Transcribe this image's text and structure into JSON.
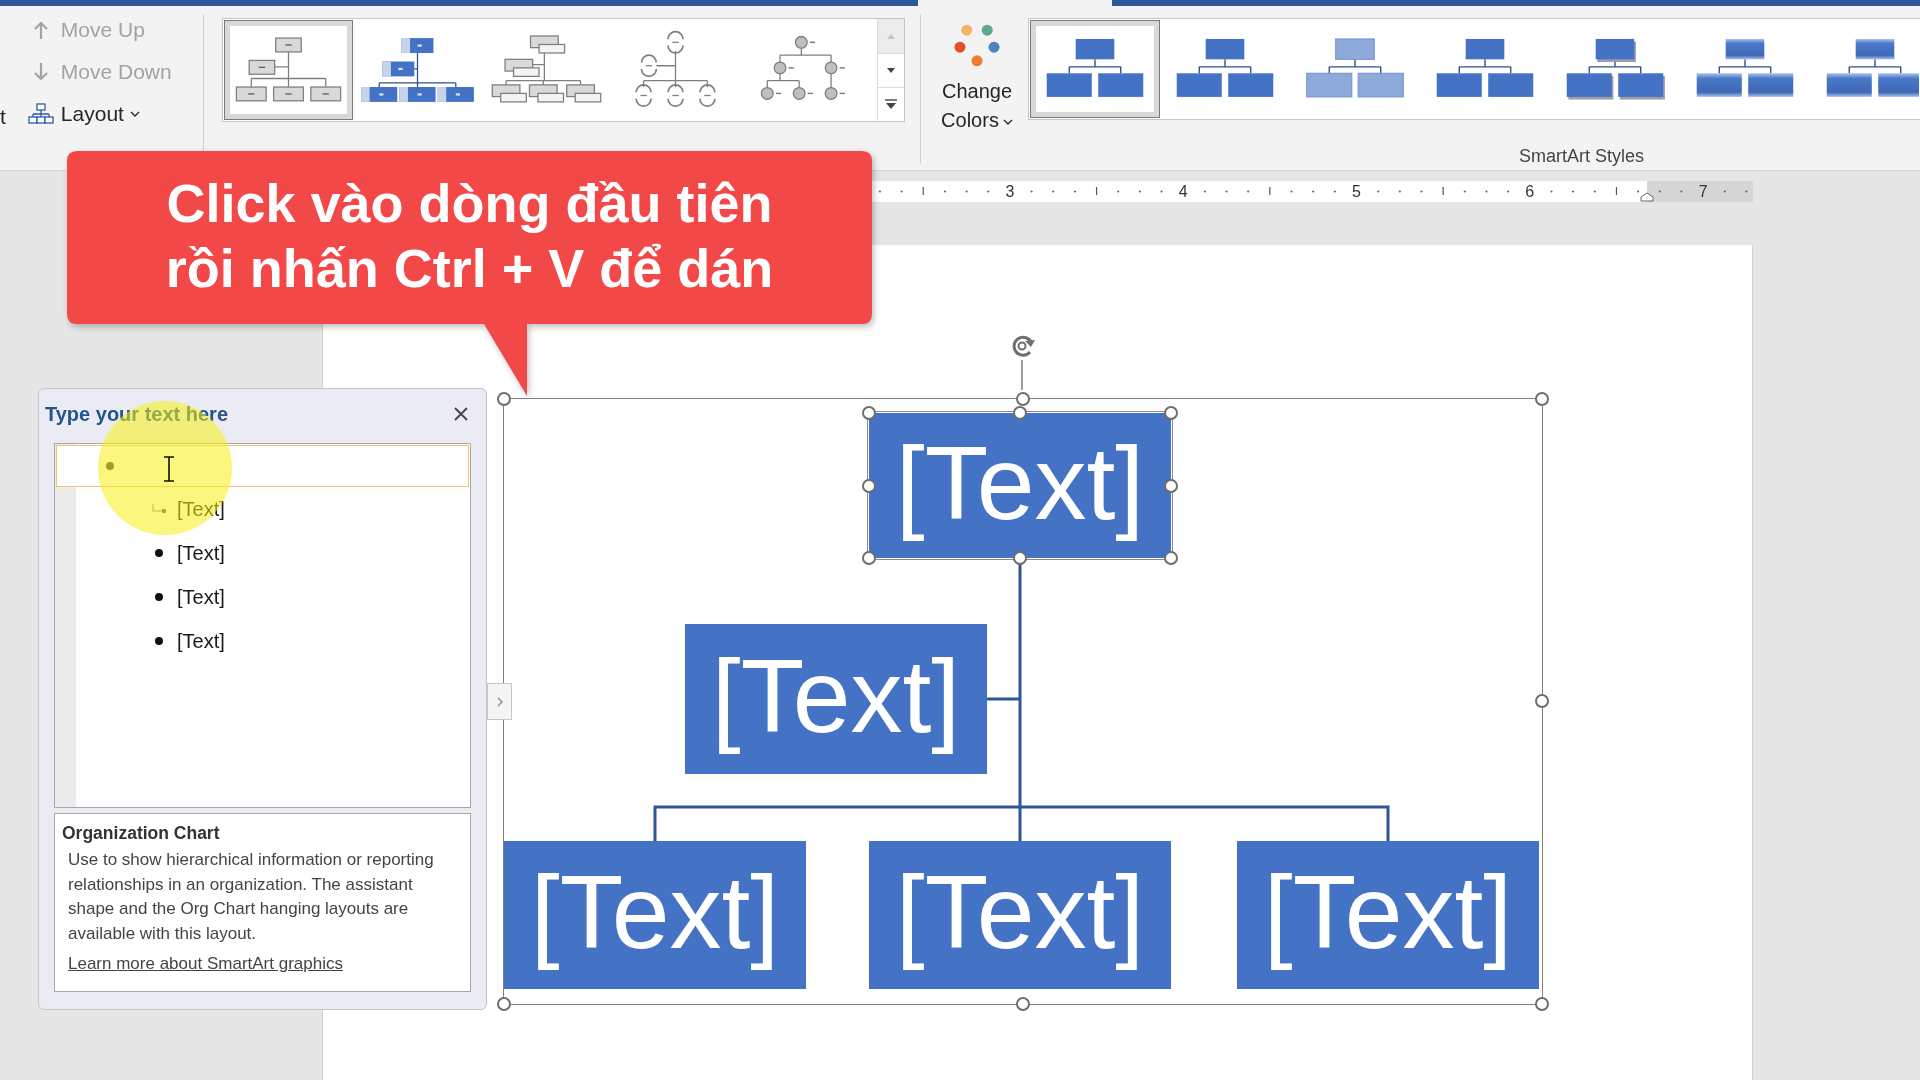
{
  "ribbon": {
    "left_edge_text": "t",
    "commands": [
      {
        "kind": "move_up",
        "label": "Move Up",
        "disabled": true
      },
      {
        "kind": "move_down",
        "label": "Move Down",
        "disabled": true
      },
      {
        "kind": "layout",
        "label": "Layout",
        "disabled": false
      }
    ],
    "layouts": [
      {
        "kind": "org_chart",
        "selected": true
      },
      {
        "kind": "picture_org_chart",
        "selected": false
      },
      {
        "kind": "name_title_org_chart",
        "selected": false
      },
      {
        "kind": "half_circle_org_chart",
        "selected": false
      },
      {
        "kind": "circle_picture_hierarchy",
        "selected": false
      }
    ],
    "change_colors": {
      "label": "Change Colors"
    },
    "styles": [
      {
        "kind": "flat",
        "selected": true
      },
      {
        "kind": "flat",
        "selected": false
      },
      {
        "kind": "subtle",
        "selected": false
      },
      {
        "kind": "flat",
        "selected": false
      },
      {
        "kind": "shadow",
        "selected": false
      },
      {
        "kind": "bevel",
        "selected": false
      },
      {
        "kind": "bevel",
        "selected": false
      }
    ],
    "styles_group_label": "SmartArt Styles"
  },
  "ruler": {
    "numbers": [
      "3",
      "4",
      "5",
      "6",
      "7"
    ]
  },
  "callout": {
    "lines": [
      "Click vào dòng đầu tiên",
      "rồi nhấn Ctrl + V để dán"
    ]
  },
  "text_pane": {
    "title": "Type your text here",
    "items": [
      {
        "selected": true,
        "children": [
          {
            "kind": "assistant",
            "text": "[Text]",
            "selected": false
          },
          {
            "kind": "bullet",
            "text": "[Text]",
            "selected": false
          },
          {
            "kind": "bullet",
            "text": "[Text]",
            "selected": false
          },
          {
            "kind": "bullet",
            "text": "[Text]",
            "selected": false
          }
        ]
      }
    ],
    "description": {
      "title": "Organization Chart",
      "body": "Use to show hierarchical information or reporting relationships in an organization. The assistant shape and the Org Chart hanging layouts are available with this layout.",
      "link": "Learn more about SmartArt graphics"
    }
  },
  "diagram": {
    "nodes": [
      {
        "kind": "top",
        "text": "[Text]",
        "selected": true
      },
      {
        "kind": "assistant",
        "text": "[Text]",
        "selected": false
      },
      {
        "kind": "staff",
        "text": "[Text]",
        "selected": false
      },
      {
        "kind": "staff",
        "text": "[Text]",
        "selected": false
      },
      {
        "kind": "staff",
        "text": "[Text]",
        "selected": false
      }
    ]
  }
}
